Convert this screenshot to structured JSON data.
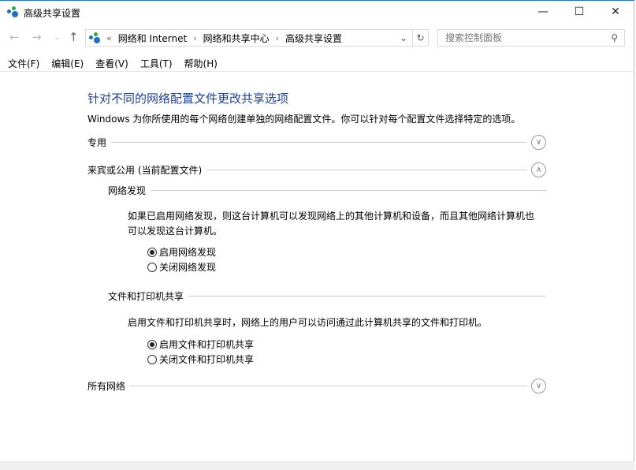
{
  "window": {
    "title": "高级共享设置"
  },
  "address": {
    "overflow": "«",
    "crumbs": [
      "网络和 Internet",
      "网络和共享中心",
      "高级共享设置"
    ]
  },
  "search": {
    "placeholder": "搜索控制面板"
  },
  "menu": [
    "文件(F)",
    "编辑(E)",
    "查看(V)",
    "工具(T)",
    "帮助(H)"
  ],
  "main": {
    "heading": "针对不同的网络配置文件更改共享选项",
    "description": "Windows 为你所使用的每个网络创建单独的网络配置文件。你可以针对每个配置文件选择特定的选项。",
    "private": "专用",
    "guest": "来宾或公用 (当前配置文件)",
    "discovery": {
      "title": "网络发现",
      "text1": "如果已启用网络发现，则这台计算机可以发现网络上的其他计算机和设备，而且其他网络计算机也",
      "text2": "可以发现这台计算机。",
      "on": "启用网络发现",
      "off": "关闭网络发现",
      "selected": "on"
    },
    "sharing": {
      "title": "文件和打印机共享",
      "text": "启用文件和打印机共享时，网络上的用户可以访问通过此计算机共享的文件和打印机。",
      "on": "启用文件和打印机共享",
      "off": "关闭文件和打印机共享",
      "selected": "on"
    },
    "all": "所有网络"
  }
}
